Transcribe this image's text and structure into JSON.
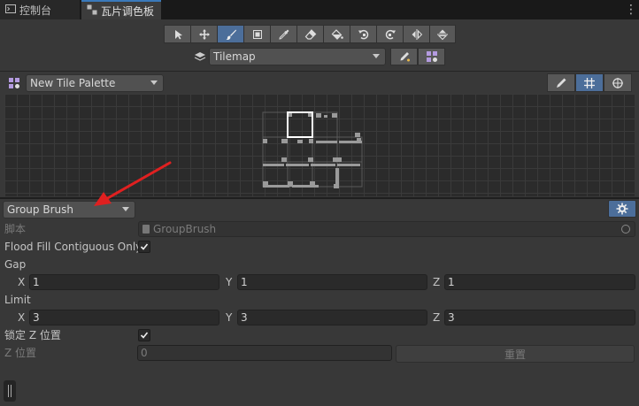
{
  "tabs": {
    "console": {
      "label": "控制台",
      "icon": "console-icon"
    },
    "palette": {
      "label": "瓦片调色板",
      "icon": "tile-palette-icon"
    },
    "menu_icon": "vertical-ellipsis-icon"
  },
  "toolbar": {
    "tools": [
      "select-icon",
      "move-icon",
      "paint-brush-icon",
      "box-fill-icon",
      "picker-icon",
      "eraser-icon",
      "fill-bucket-icon",
      "rotate-ccw-icon",
      "rotate-cw-icon",
      "flip-x-icon",
      "flip-y-icon"
    ],
    "active_tool": "paint-brush-icon"
  },
  "tilemap": {
    "selected": "Tilemap"
  },
  "palette": {
    "selected": "New Tile Palette",
    "view_tools": [
      "edit-pencil-icon",
      "grid-icon",
      "gizmos-icon"
    ],
    "active_view_tool": "grid-icon"
  },
  "brush": {
    "selected": "Group Brush",
    "script_label": "脚本",
    "script_value": "GroupBrush",
    "flood_fill_label": "Flood Fill Contiguous Only",
    "flood_fill_checked": true,
    "gap_label": "Gap",
    "gap": {
      "x_label": "X",
      "x": "1",
      "y_label": "Y",
      "y": "1",
      "z_label": "Z",
      "z": "1"
    },
    "limit_label": "Limit",
    "limit": {
      "x_label": "X",
      "x": "3",
      "y_label": "Y",
      "y": "3",
      "z_label": "Z",
      "z": "3"
    },
    "lock_z_label": "锁定 Z 位置",
    "lock_z_checked": true,
    "z_position_label": "Z 位置",
    "z_position_value": "0",
    "reset_label": "重置"
  },
  "colors": {
    "accent": "#4c6e9a",
    "annotation_arrow": "#e02020"
  }
}
